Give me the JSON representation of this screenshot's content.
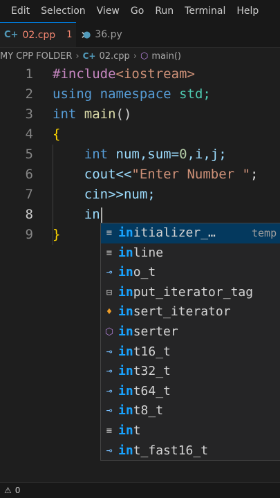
{
  "menu": [
    "Edit",
    "Selection",
    "View",
    "Go",
    "Run",
    "Terminal",
    "Help"
  ],
  "tabs": [
    {
      "label": "02.cpp",
      "problems": "1",
      "close": "✕",
      "icon": "cpp-file-icon"
    },
    {
      "label": "36.py",
      "icon": "python-file-icon"
    }
  ],
  "breadcrumb": {
    "folder": "MY CPP FOLDER",
    "file": "02.cpp",
    "symbol": "main()"
  },
  "editor": {
    "line_numbers": [
      "1",
      "2",
      "3",
      "4",
      "5",
      "6",
      "7",
      "8",
      "9"
    ],
    "current_line": "8",
    "lines": [
      [
        "#include",
        "<iostream>"
      ],
      [
        "using",
        "namespace",
        "std;"
      ],
      [
        "int",
        "main",
        "()"
      ],
      [
        "{"
      ],
      [
        "int",
        "num,sum=",
        "0",
        ",i,j;"
      ],
      [
        "cout<<",
        "\"Enter Number \"",
        ";"
      ],
      [
        "cin>>num;"
      ],
      [
        "in"
      ],
      [
        "}"
      ]
    ]
  },
  "suggestions": {
    "typed": "in",
    "items": [
      {
        "rest": "itializer_…",
        "detail": "temp",
        "icon": "keyword-icon",
        "selected": true
      },
      {
        "rest": "line",
        "icon": "keyword-icon"
      },
      {
        "rest": "o_t",
        "icon": "reference-icon"
      },
      {
        "rest": "put_iterator_tag",
        "icon": "struct-icon"
      },
      {
        "rest": "sert_iterator",
        "icon": "class-icon"
      },
      {
        "rest": "serter",
        "icon": "cube-icon"
      },
      {
        "rest": "t16_t",
        "icon": "reference-icon"
      },
      {
        "rest": "t32_t",
        "icon": "reference-icon"
      },
      {
        "rest": "t64_t",
        "icon": "reference-icon"
      },
      {
        "rest": "t8_t",
        "icon": "reference-icon"
      },
      {
        "rest": "t",
        "icon": "keyword-icon"
      },
      {
        "rest": "t_fast16_t",
        "icon": "reference-icon"
      }
    ]
  },
  "status": {
    "warnings": "0"
  }
}
